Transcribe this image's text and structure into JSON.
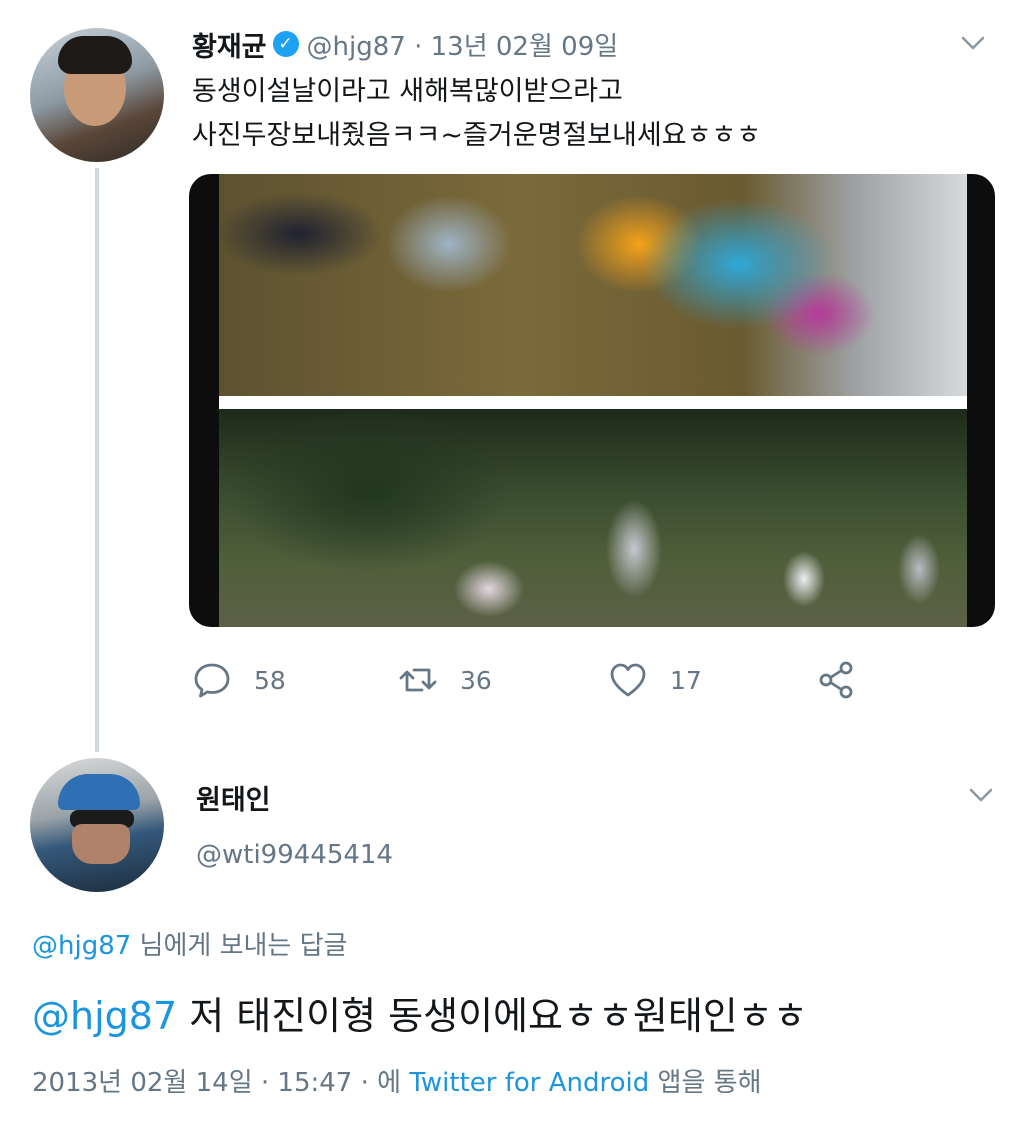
{
  "tweet": {
    "display_name": "황재균",
    "verified_icon": "verified-badge-icon",
    "meta": "@hjg87 · 13년 02월 09일",
    "text_line1": "동생이설날이라고 새해복많이받으라고",
    "text_line2": "사진두장보내줬음ㅋㅋ~즐거운명절보내세요ㅎㅎㅎ",
    "actions": {
      "reply_count": "58",
      "retweet_count": "36",
      "like_count": "17"
    }
  },
  "reply": {
    "display_name": "원태인",
    "handle": "@wti99445414",
    "replying_to_handle": "@hjg87",
    "replying_to_suffix": " 님에게 보내는 답글",
    "mention": "@hjg87",
    "text": " 저 태진이형 동생이에요ㅎㅎ원태인ㅎㅎ",
    "timestamp": "2013년 02월 14일 · 15:47 · 에 ",
    "via_app": "Twitter for Android",
    "via_suffix": " 앱을 통해"
  },
  "colors": {
    "accent": "#1da1f2",
    "link": "#1b95e0",
    "muted": "#657786"
  }
}
